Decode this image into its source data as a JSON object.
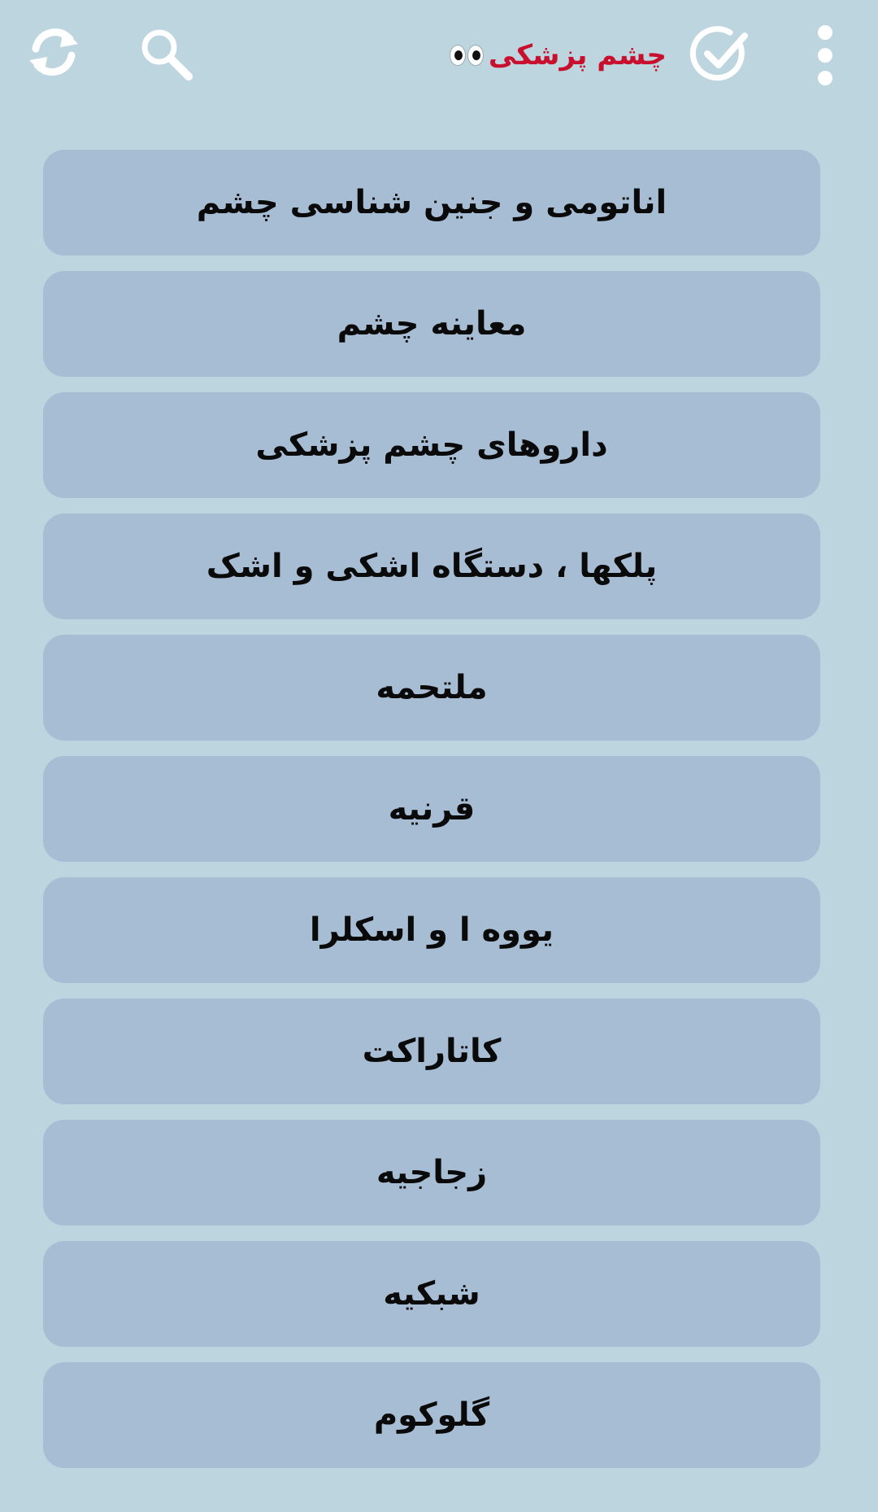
{
  "app": {
    "title": "چشم پزشکی"
  },
  "toolbar": {
    "icons": [
      "refresh-icon",
      "search-icon",
      "check-icon",
      "more-vert-icon"
    ]
  },
  "colors": {
    "background": "#bdd5df",
    "item_background": "#a7bdd4",
    "title": "#c8102e",
    "icon": "#ffffff"
  },
  "menu": {
    "items": [
      {
        "label": "اناتومی و جنین شناسی چشم"
      },
      {
        "label": "معاینه چشم"
      },
      {
        "label": "داروهای چشم پزشکی"
      },
      {
        "label": "پلکها ، دستگاه  اشکی و اشک"
      },
      {
        "label": "ملتحمه"
      },
      {
        "label": "قرنیه"
      },
      {
        "label": "یووه ا و اسکلرا"
      },
      {
        "label": "کاتاراکت"
      },
      {
        "label": "زجاجیه"
      },
      {
        "label": "شبکیه"
      },
      {
        "label": "گلوکوم"
      }
    ]
  }
}
